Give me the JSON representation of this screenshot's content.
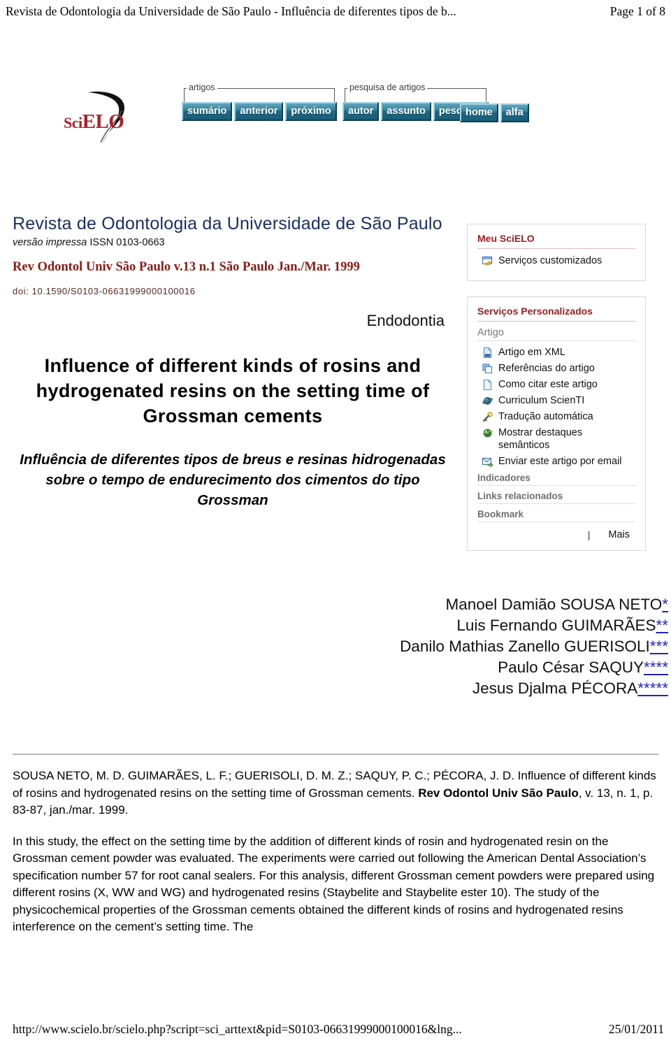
{
  "print_header": {
    "title": "Revista de Odontologia da Universidade de São Paulo - Influência de diferentes tipos de b...",
    "page": "Page 1 of 8"
  },
  "banner": {
    "logo_sci": "Sci",
    "logo_elo": "ELO",
    "groups": [
      {
        "label": "artigos",
        "buttons": [
          "sumário",
          "anterior",
          "próximo"
        ]
      },
      {
        "label": "pesquisa de artigos",
        "buttons": [
          "autor",
          "assunto",
          "pesquisa"
        ]
      },
      {
        "label": "",
        "buttons": [
          "home",
          "alfa"
        ]
      }
    ]
  },
  "journal": {
    "title": "Revista de Odontologia da Universidade de São Paulo",
    "issn_prefix": "versão impressa",
    "issn": "ISSN 0103-0663",
    "issue": "Rev Odontol Univ São Paulo v.13 n.1 São Paulo Jan./Mar. 1999",
    "doi": "doi: 10.1590/S0103-06631999000100016",
    "section": "Endodontia"
  },
  "article": {
    "title": "Influence of different kinds of rosins and hydrogenated resins on the setting time of Grossman cements",
    "subtitle": "Influência de diferentes tipos de breus e resinas hidrogenadas sobre o tempo de endurecimento dos cimentos do tipo Grossman",
    "authors": [
      {
        "name": "Manoel Damião SOUSA NETO",
        "marks": "*"
      },
      {
        "name": "Luis Fernando GUIMARÃES",
        "marks": "**"
      },
      {
        "name": "Danilo Mathias Zanello GUERISOLI",
        "marks": "***"
      },
      {
        "name": "Paulo César SAQUY",
        "marks": "****"
      },
      {
        "name": "Jesus Djalma PÉCORA",
        "marks": "*****"
      }
    ]
  },
  "sidebar": {
    "my_scielo": {
      "title": "Meu SciELO",
      "items": [
        {
          "label": "Serviços customizados",
          "icon": "customize-window-icon"
        }
      ]
    },
    "personalized": {
      "title": "Serviços Personalizados",
      "group_label": "Artigo",
      "items": [
        {
          "label": "Artigo em XML",
          "icon": "xml-document-icon"
        },
        {
          "label": "Referências do artigo",
          "icon": "copy-pages-icon"
        },
        {
          "label": "Como citar este artigo",
          "icon": "page-icon"
        },
        {
          "label": "Curriculum ScienTI",
          "icon": "globe-icon"
        },
        {
          "label": "Tradução automática",
          "icon": "key-icon"
        },
        {
          "label": "Mostrar destaques semânticos",
          "icon": "green-globe-icon"
        },
        {
          "label": "Enviar este artigo por email",
          "icon": "mail-forward-icon"
        }
      ],
      "sections": [
        "Indicadores",
        "Links relacionados",
        "Bookmark"
      ],
      "more_label": "Mais",
      "divider_glyph": "|"
    }
  },
  "abstract": {
    "citation_pre": "SOUSA NETO, M. D. GUIMARÃES, L. F.; GUERISOLI, D. M. Z.; SAQUY, P. C.; PÉCORA, J. D. Influence of different kinds of rosins and hydrogenated resins on the setting time of Grossman cements. ",
    "citation_journal": "Rev Odontol Univ São Paulo",
    "citation_post": ", v. 13, n. 1, p. 83-87, jan./mar. 1999.",
    "body": "In this study, the effect on the setting time by the addition of different kinds of rosin and hydrogenated resin on the Grossman cement powder was evaluated. The experiments were carried out following the American Dental Association’s specification number 57 for root canal sealers. For this analysis, different Grossman cement powders were prepared using different rosins (X, WW and WG) and hydrogenated resins (Staybelite and Staybelite ester 10). The study of the physicochemical properties of the Grossman cements obtained the different kinds of rosins and hydrogenated resins interference on the cement’s setting time. The"
  },
  "footer": {
    "url": "http://www.scielo.br/scielo.php?script=sci_arttext&pid=S0103-06631999000100016&lng...",
    "date": "25/01/2011"
  },
  "colors": {
    "brand_red": "#b01c28",
    "panel_heading_red": "#9e1b1b",
    "journal_blue": "#1a2f66",
    "issue_red": "#8b1a12",
    "nav_button_blue": "#2e7e9b",
    "link_blue": "#2222cc"
  }
}
